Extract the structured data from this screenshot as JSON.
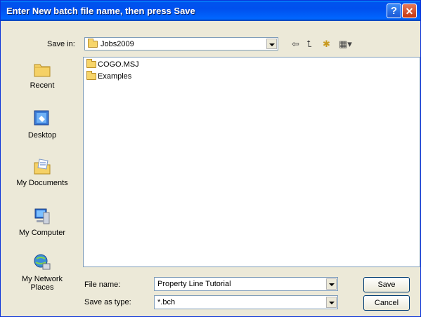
{
  "window": {
    "title": "Enter New batch file name, then press Save",
    "help": "?",
    "close": "✕"
  },
  "toolbar": {
    "save_in_label": "Save in:",
    "save_in_value": "Jobs2009",
    "back": "⇦",
    "up": "⮤",
    "new_folder": "✱",
    "views": "▦▾"
  },
  "places": [
    {
      "label": "Recent"
    },
    {
      "label": "Desktop"
    },
    {
      "label": "My Documents"
    },
    {
      "label": "My Computer"
    },
    {
      "label": "My Network Places"
    }
  ],
  "files": [
    {
      "name": "COGO.MSJ"
    },
    {
      "name": "Examples"
    }
  ],
  "form": {
    "file_name_label": "File name:",
    "file_name_value": "Property Line Tutorial",
    "save_type_label": "Save as type:",
    "save_type_value": "*.bch",
    "save_button": "Save",
    "cancel_button": "Cancel"
  },
  "colors": {
    "titlebar": "#0055ea",
    "dialog_bg": "#ece9d8",
    "folder": "#f7d56a"
  }
}
